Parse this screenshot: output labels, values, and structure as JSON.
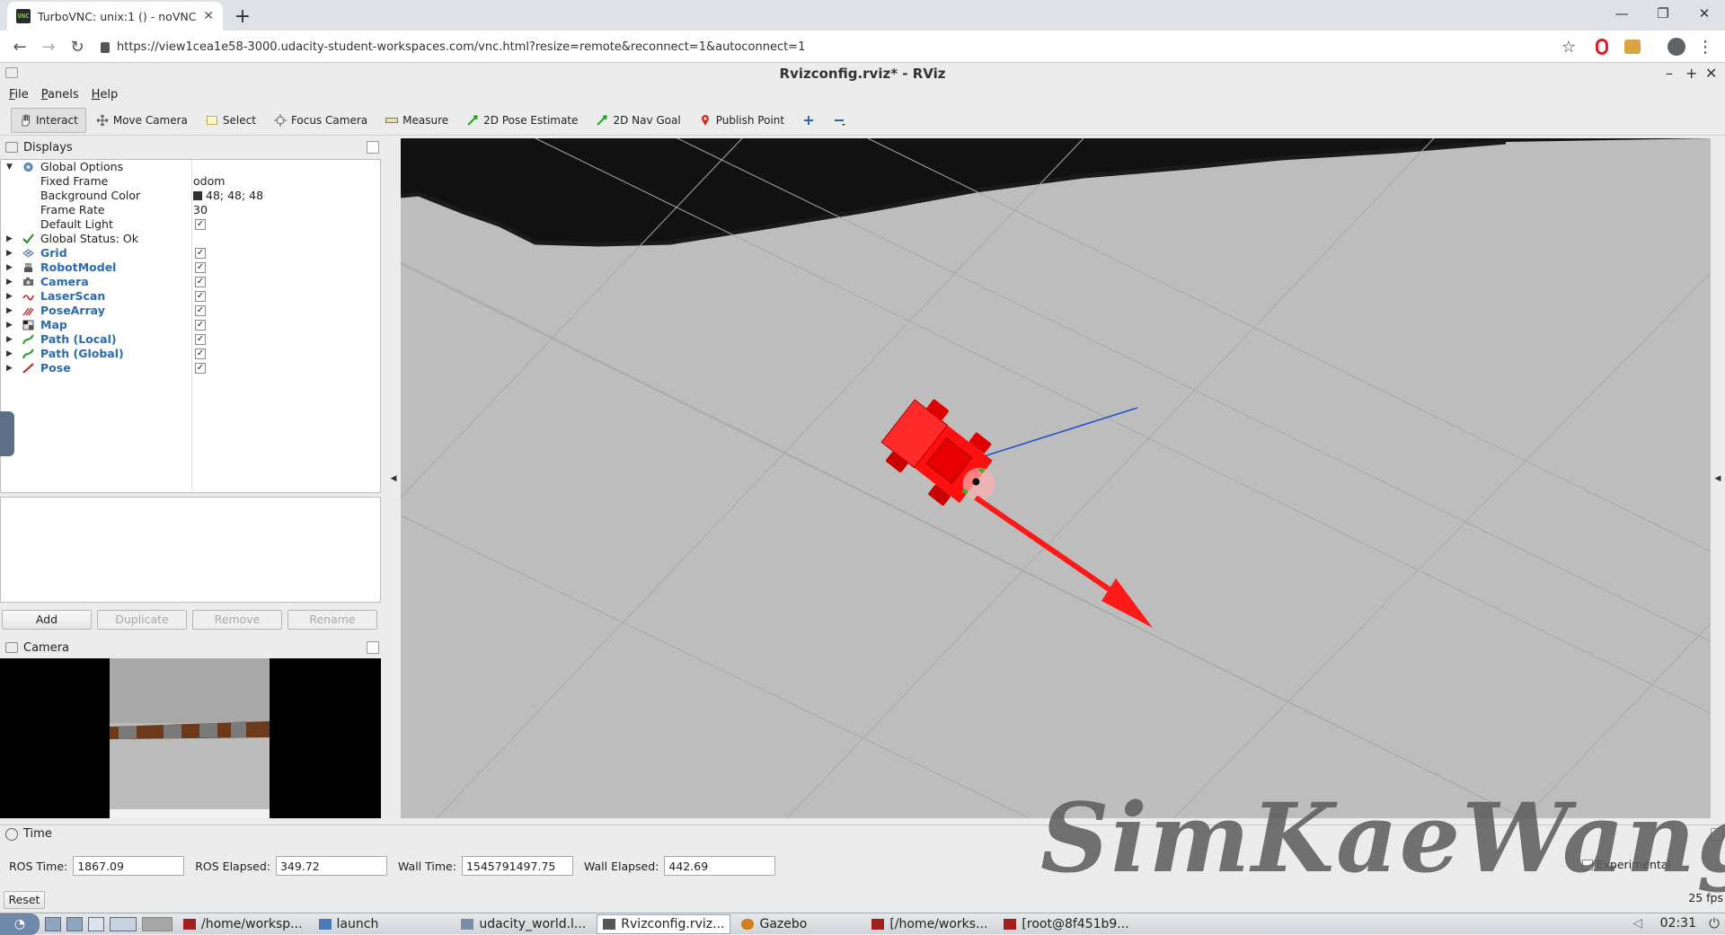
{
  "browser": {
    "tab_title": "TurboVNC: unix:1 () - noVNC",
    "tab_favicon": "VNC",
    "url": "https://view1cea1e58-3000.udacity-student-workspaces.com/vnc.html?resize=remote&reconnect=1&autoconnect=1"
  },
  "window": {
    "title": "Rvizconfig.rviz* - RViz"
  },
  "menu": [
    "File",
    "Panels",
    "Help"
  ],
  "toolbar": [
    {
      "label": "Interact",
      "icon": "hand-icon"
    },
    {
      "label": "Move Camera",
      "icon": "move-camera-icon"
    },
    {
      "label": "Select",
      "icon": "select-icon"
    },
    {
      "label": "Focus Camera",
      "icon": "focus-camera-icon"
    },
    {
      "label": "Measure",
      "icon": "measure-icon"
    },
    {
      "label": "2D Pose Estimate",
      "icon": "pose-estimate-icon"
    },
    {
      "label": "2D Nav Goal",
      "icon": "nav-goal-icon"
    },
    {
      "label": "Publish Point",
      "icon": "publish-point-icon"
    }
  ],
  "displays": {
    "title": "Displays",
    "global_options": {
      "label": "Global Options",
      "fixed_frame_label": "Fixed Frame",
      "fixed_frame": "odom",
      "background_color_label": "Background Color",
      "background_color": "48; 48; 48",
      "frame_rate_label": "Frame Rate",
      "frame_rate": "30",
      "default_light_label": "Default Light"
    },
    "global_status": "Global Status: Ok",
    "items": [
      {
        "label": "Grid",
        "color": "#4a6fa0"
      },
      {
        "label": "RobotModel",
        "color": "#555555"
      },
      {
        "label": "Camera",
        "color": "#555555"
      },
      {
        "label": "LaserScan",
        "color": "#cc2020"
      },
      {
        "label": "PoseArray",
        "color": "#cc2020"
      },
      {
        "label": "Map",
        "color": "#555555"
      },
      {
        "label": "Path (Local)",
        "color": "#1ea01e"
      },
      {
        "label": "Path (Global)",
        "color": "#1ea01e"
      },
      {
        "label": "Pose",
        "color": "#cc2020"
      }
    ],
    "buttons": {
      "add": "Add",
      "duplicate": "Duplicate",
      "remove": "Remove",
      "rename": "Rename"
    }
  },
  "camera_panel": {
    "title": "Camera"
  },
  "time_panel": {
    "title": "Time",
    "ros_time_label": "ROS Time:",
    "ros_time": "1867.09",
    "ros_elapsed_label": "ROS Elapsed:",
    "ros_elapsed": "349.72",
    "wall_time_label": "Wall Time:",
    "wall_time": "1545791497.75",
    "wall_elapsed_label": "Wall Elapsed:",
    "wall_elapsed": "442.69",
    "experimental": "Experimental",
    "reset": "Reset",
    "fps": "25 fps"
  },
  "taskbar": {
    "items": [
      {
        "label": "/home/worksp..."
      },
      {
        "label": "launch"
      },
      {
        "label": "udacity_world.l..."
      },
      {
        "label": "Rvizconfig.rviz..."
      },
      {
        "label": "Gazebo"
      },
      {
        "label": "[/home/works..."
      },
      {
        "label": "[root@8f451b9..."
      }
    ],
    "clock": "02:31"
  },
  "watermark": "SimKaeWang",
  "colors": {
    "robot": "#ff0000",
    "map_free": "#bdbdbd",
    "map_occupied": "#111111",
    "plugin_text": "#2a6bb0"
  }
}
